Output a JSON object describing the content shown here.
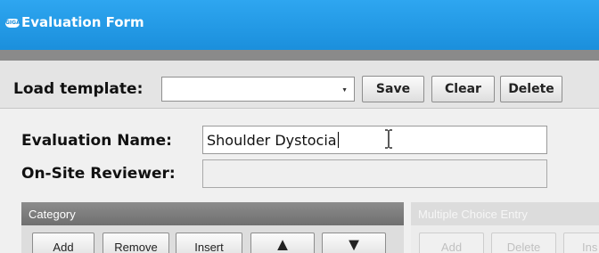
{
  "window": {
    "logo_text": "GIGA",
    "title": "Evaluation Form"
  },
  "toolbar": {
    "load_template_label": "Load template:",
    "template_select_value": "",
    "save_label": "Save",
    "clear_label": "Clear",
    "delete_label": "Delete"
  },
  "form": {
    "evaluation_name_label": "Evaluation Name:",
    "evaluation_name_value": "Shoulder Dystocia",
    "onsite_reviewer_label": "On-Site Reviewer:",
    "onsite_reviewer_value": ""
  },
  "category_panel": {
    "header": "Category",
    "buttons": {
      "add": "Add",
      "remove": "Remove",
      "insert": "Insert",
      "up": "▲",
      "down": "▼"
    }
  },
  "multiple_choice_panel": {
    "header": "Multiple Choice Entry",
    "buttons": {
      "add": "Add",
      "delete": "Delete",
      "insert": "Ins"
    }
  },
  "colors": {
    "titlebar": "#1b8fdc",
    "panel_header": "#7a7a7a"
  }
}
